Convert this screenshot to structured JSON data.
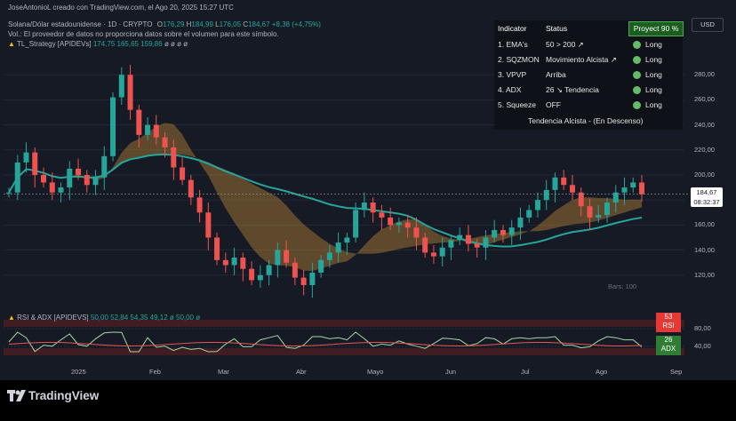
{
  "header": {
    "attribution": "JoseAntonioL creado con TradingView.com, el Ago 20, 2025 15:27 UTC",
    "symbol_line": "Solana/Dólar estadounidense · 1D · CRYPTO",
    "ohlc": {
      "o_label": "O",
      "o": "176,29",
      "h_label": "H",
      "h": "184,99",
      "l_label": "L",
      "l": "176,05",
      "c_label": "C",
      "c": "184,67",
      "change": "+8,38 (+4,75%)"
    },
    "volume_note": "Vol.: El proveedor de datos no proporciona datos sobre el volumen para este símbolo.",
    "strategy_name": "TL_Strategy [APIDEVs]",
    "strategy_values": "174,75",
    "strategy_values_2": "165,65",
    "strategy_values_3": "159,86",
    "strategy_tail": "ø ø ø ø",
    "rsi_adx_name": "RSI & ADX [APIDEVS]",
    "rsi_values": [
      "50,00",
      "52,84",
      "54,35",
      "49,12",
      "ø",
      "50,00",
      "ø"
    ]
  },
  "indicator_table": {
    "col_indicator": "Indicator",
    "col_status": "Status",
    "projection": "Proyect 90 %",
    "rows": [
      {
        "name": "1. EMA's",
        "status": "50 > 200 ↗",
        "signal": "Long"
      },
      {
        "name": "2. SQZMON",
        "status": "Movimiento Alcista ↗",
        "signal": "Long"
      },
      {
        "name": "3. VPVP",
        "status": "Arriba",
        "signal": "Long"
      },
      {
        "name": "4. ADX",
        "status": "26 ↘ Tendencia",
        "signal": "Long"
      },
      {
        "name": "5. Squeeze",
        "status": "OFF",
        "signal": "Long"
      }
    ],
    "summary": "Tendencia Alcista - (En Descenso)"
  },
  "currency_button": "USD",
  "last_price": "184,67",
  "countdown": "08:32:37",
  "bars_label": "Bars: 100",
  "rsi_badge": {
    "value": "53",
    "label": "RSI"
  },
  "adx_badge": {
    "value": "26",
    "label": "ADX"
  },
  "branding": "TradingView",
  "colors": {
    "bg": "#161a25",
    "up": "#26a69a",
    "down": "#ef5350",
    "buy": "#4caf50",
    "sell": "#e53935"
  },
  "chart_data": {
    "type": "candlestick",
    "y_ticks": [
      120,
      140,
      160,
      180,
      200,
      220,
      240,
      260,
      280
    ],
    "ylim": [
      95,
      300
    ],
    "x_ticks": [
      "2025",
      "Feb",
      "Mar",
      "Abr",
      "Mayo",
      "Jun",
      "Jul",
      "Ago",
      "Sep"
    ],
    "last_price": 184.67,
    "close_series": [
      186,
      210,
      218,
      200,
      194,
      186,
      190,
      205,
      200,
      192,
      198,
      215,
      262,
      280,
      252,
      232,
      240,
      230,
      222,
      206,
      196,
      182,
      170,
      150,
      132,
      128,
      134,
      125,
      116,
      120,
      128,
      140,
      130,
      118,
      112,
      122,
      132,
      138,
      146,
      150,
      172,
      178,
      170,
      166,
      160,
      162,
      158,
      150,
      138,
      135,
      142,
      148,
      152,
      145,
      142,
      150,
      156,
      152,
      158,
      166,
      172,
      180,
      188,
      198,
      192,
      186,
      175,
      166,
      168,
      178,
      186,
      190,
      194,
      184.67
    ],
    "rsi_ticks": [
      40,
      80
    ],
    "rsi_last": 53,
    "adx_last": 26
  }
}
